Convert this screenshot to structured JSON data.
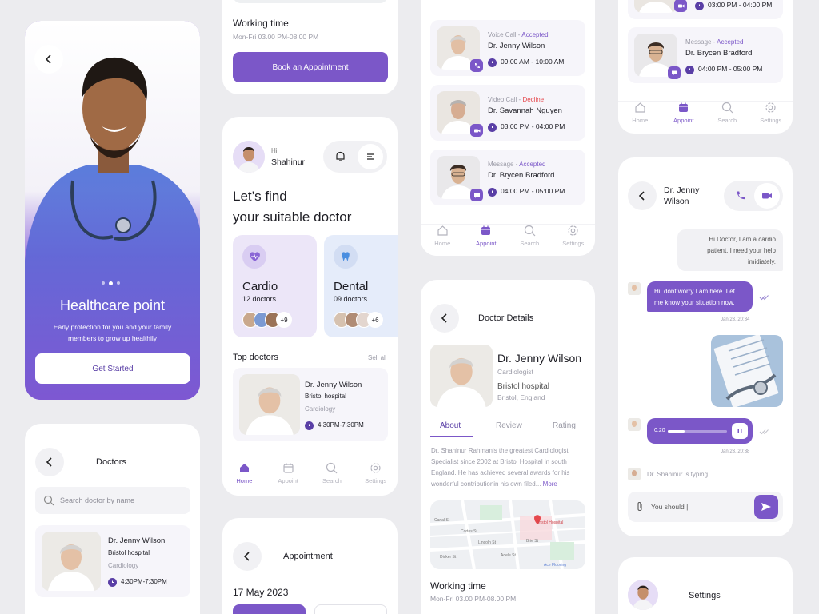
{
  "colors": {
    "accent": "#7b57c8",
    "accent_dark": "#5a3fa6",
    "decline": "#e5484d",
    "background": "#ececef"
  },
  "onboarding": {
    "title": "Healthcare point",
    "subtitle_line1": "Early protection for you and your family",
    "subtitle_line2": "members to grow up healthily",
    "cta": "Get Started",
    "back_icon": "chevron-left-icon"
  },
  "doctors_list": {
    "title": "Doctors",
    "search_placeholder": "Search doctor by name",
    "first": {
      "name": "Dr. Jenny Wilson",
      "hospital": "Bristol hospital",
      "specialty": "Cardiology",
      "time": "4:30PM-7:30PM"
    }
  },
  "booking_top": {
    "working_time_label": "Working time",
    "working_time_value": "Mon-Fri 03.00 PM-08.00 PM",
    "cta": "Book an Appointment"
  },
  "home": {
    "greeting": "Hi,",
    "user": "Shahinur",
    "headline_line1": "Let’s find",
    "headline_line2": "your suitable doctor",
    "categories": [
      {
        "name": "Cardio",
        "count": "12 doctors",
        "more": "+9",
        "icon": "heart-pulse-icon"
      },
      {
        "name": "Dental",
        "count": "09 doctors",
        "more": "+6",
        "icon": "tooth-icon"
      }
    ],
    "top_doctors_label": "Top doctors",
    "see_all": "Sell all",
    "top_doctor": {
      "name": "Dr. Jenny Wilson",
      "hospital": "Bristol hospital",
      "specialty": "Cardiology",
      "time": "4:30PM-7:30PM"
    },
    "tabs": [
      "Home",
      "Appoint",
      "Search",
      "Settings"
    ]
  },
  "appointment_screen": {
    "title": "Appointment",
    "date": "17 May 2023"
  },
  "appointments": {
    "items": [
      {
        "type": "Voice Call",
        "sep": " - ",
        "status": "Accepted",
        "name": "Dr. Jenny Wilson",
        "time": "09:00 AM - 10:00 AM"
      },
      {
        "type": "Video Call",
        "sep": " - ",
        "status": "Decline",
        "name": "Dr. Savannah Nguyen",
        "time": "03:00 PM - 04:00 PM"
      },
      {
        "type": "Message",
        "sep": " - ",
        "status": "Accepted",
        "name": "Dr. Brycen Bradford",
        "time": "04:00 PM - 05:00 PM"
      }
    ],
    "tabs": [
      "Home",
      "Appoint",
      "Search",
      "Settings"
    ]
  },
  "doctor_details": {
    "title": "Doctor Details",
    "name": "Dr. Jenny Wilson",
    "specialty": "Cardiologist",
    "hospital": "Bristol hospital",
    "location": "Bristol, England",
    "tabs": [
      "About",
      "Review",
      "Rating"
    ],
    "about_line1": "Dr. Shahinur Rahmanis the greatest Cardiologist",
    "about_line2": "Specialist since 2002 at Bristol Hospital in south",
    "about_line3": "England. He has achieved several awards for his",
    "about_line4": "wonderful contributionin his own filed...",
    "more": "More",
    "map_label": "Bristol Hospital",
    "map_streets": [
      "Canal St",
      "Cortes St",
      "Dicker St",
      "Adele St",
      "Lincoln St",
      "Brie St",
      "Ace Flooring"
    ],
    "working_time_label": "Working time",
    "working_time_value": "Mon-Fri 03.00 PM-08.00 PM"
  },
  "appointments_right": {
    "top_time": "03:00 PM - 04:00 PM",
    "item": {
      "type": "Message",
      "sep": " - ",
      "status": "Accepted",
      "name": "Dr. Brycen Bradford",
      "time": "04:00 PM - 05:00 PM"
    },
    "tabs": [
      "Home",
      "Appoint",
      "Search",
      "Settings"
    ]
  },
  "chat": {
    "contact_line1": "Dr. Jenny",
    "contact_line2": "Wilson",
    "msg1_line1": "Hi Doctor, I am a cardio",
    "msg1_line2": "patient. I need your help",
    "msg1_line3": "imidiately.",
    "msg2_line1": "Hi, dont worry I am here. Let",
    "msg2_line2": "me know your situation now.",
    "msg2_time": "Jan 23, 20:34",
    "voice_time": "0:20",
    "voice_stamp": "Jan 23, 20:38",
    "typing": "Dr. Shahinur is typing . . .",
    "input_value": "You should |"
  },
  "settings": {
    "title": "Settings"
  }
}
